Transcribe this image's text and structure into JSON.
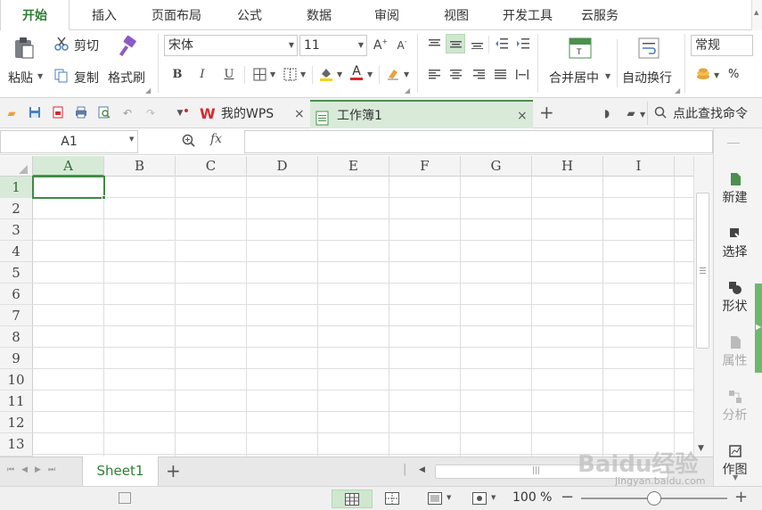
{
  "menu": {
    "tabs": [
      "开始",
      "插入",
      "页面布局",
      "公式",
      "数据",
      "审阅",
      "视图",
      "开发工具",
      "云服务"
    ],
    "active_index": 0
  },
  "ribbon": {
    "paste_label": "粘贴",
    "cut_label": "剪切",
    "copy_label": "复制",
    "format_painter_label": "格式刷",
    "font_name": "宋体",
    "font_size": "11",
    "merge_label": "合并居中",
    "wrap_label": "自动换行",
    "number_format": "常规",
    "bold": "B",
    "italic": "I",
    "underline": "U",
    "font_color_glyph": "A",
    "percent": "%",
    "increase_font": "A",
    "decrease_font": "A"
  },
  "doc_tabs": {
    "wps_label": "我的WPS",
    "workbook_label": "工作簿1",
    "search_label": "点此查找命令"
  },
  "formula_bar": {
    "name_box": "A1",
    "fx": "fx",
    "value": ""
  },
  "grid": {
    "columns": [
      "A",
      "B",
      "C",
      "D",
      "E",
      "F",
      "G",
      "H",
      "I"
    ],
    "rows": [
      "1",
      "2",
      "3",
      "4",
      "5",
      "6",
      "7",
      "8",
      "9",
      "10",
      "11",
      "12",
      "13"
    ],
    "active_cell": "A1"
  },
  "sheet": {
    "tab_label": "Sheet1",
    "add_label": "+"
  },
  "status": {
    "zoom": "100 %",
    "zoom_level_fraction": 0.5
  },
  "right_panel": {
    "items": [
      "新建",
      "选择",
      "形状",
      "属性",
      "分析",
      "作图"
    ]
  },
  "watermark": {
    "text": "Baidu经验",
    "sub": "jingyan.baidu.com"
  },
  "colors": {
    "accent": "#2f7d35",
    "active_header": "#d7ead8",
    "wps_red": "#d9262c"
  }
}
